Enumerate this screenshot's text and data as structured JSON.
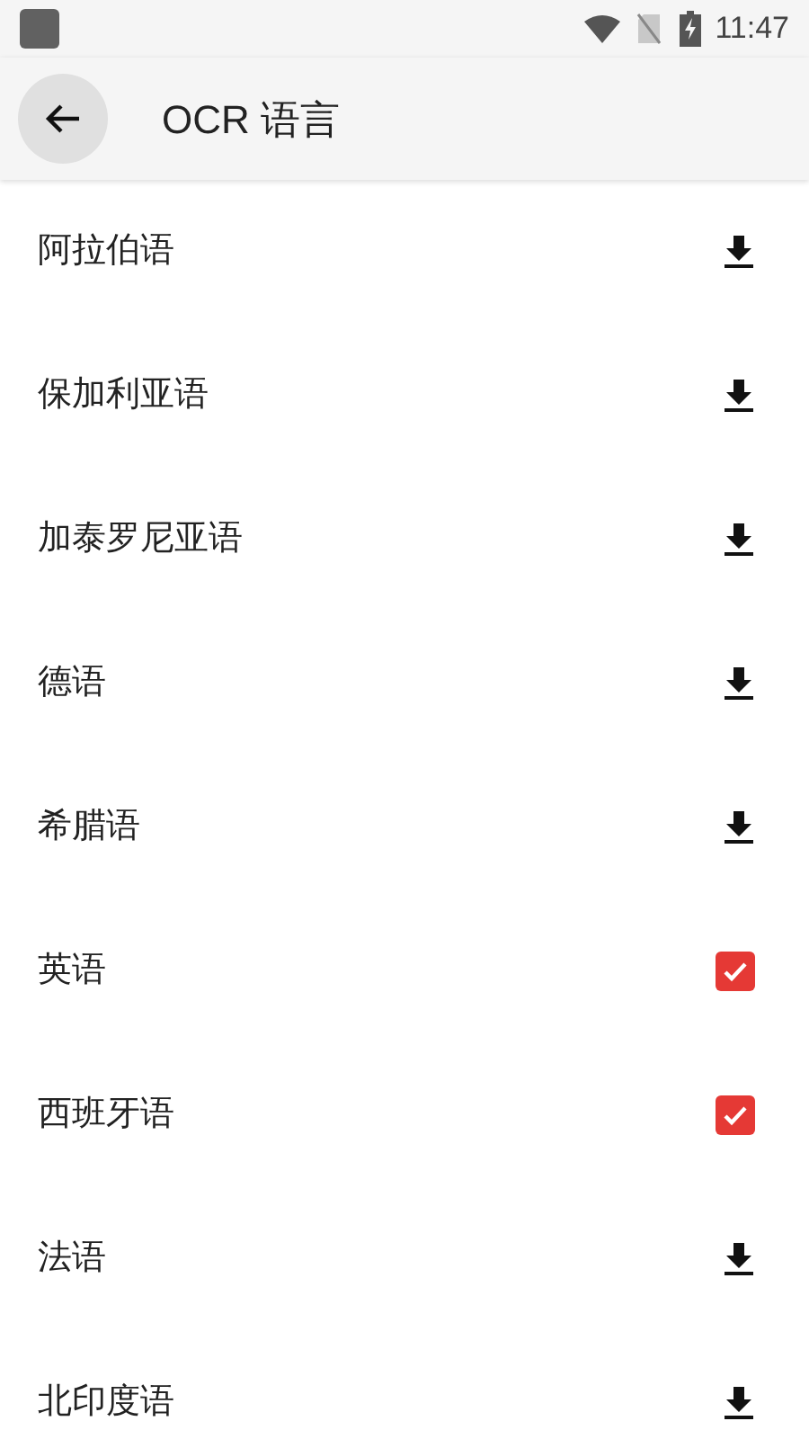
{
  "status_bar": {
    "time": "11:47"
  },
  "header": {
    "title": "OCR 语言"
  },
  "languages": [
    {
      "name": "阿拉伯语",
      "kind": "download"
    },
    {
      "name": "保加利亚语",
      "kind": "download"
    },
    {
      "name": "加泰罗尼亚语",
      "kind": "download"
    },
    {
      "name": "德语",
      "kind": "download"
    },
    {
      "name": "希腊语",
      "kind": "download"
    },
    {
      "name": "英语",
      "kind": "checkbox",
      "checked": true
    },
    {
      "name": "西班牙语",
      "kind": "checkbox",
      "checked": true
    },
    {
      "name": "法语",
      "kind": "download"
    },
    {
      "name": "北印度语",
      "kind": "download"
    }
  ]
}
